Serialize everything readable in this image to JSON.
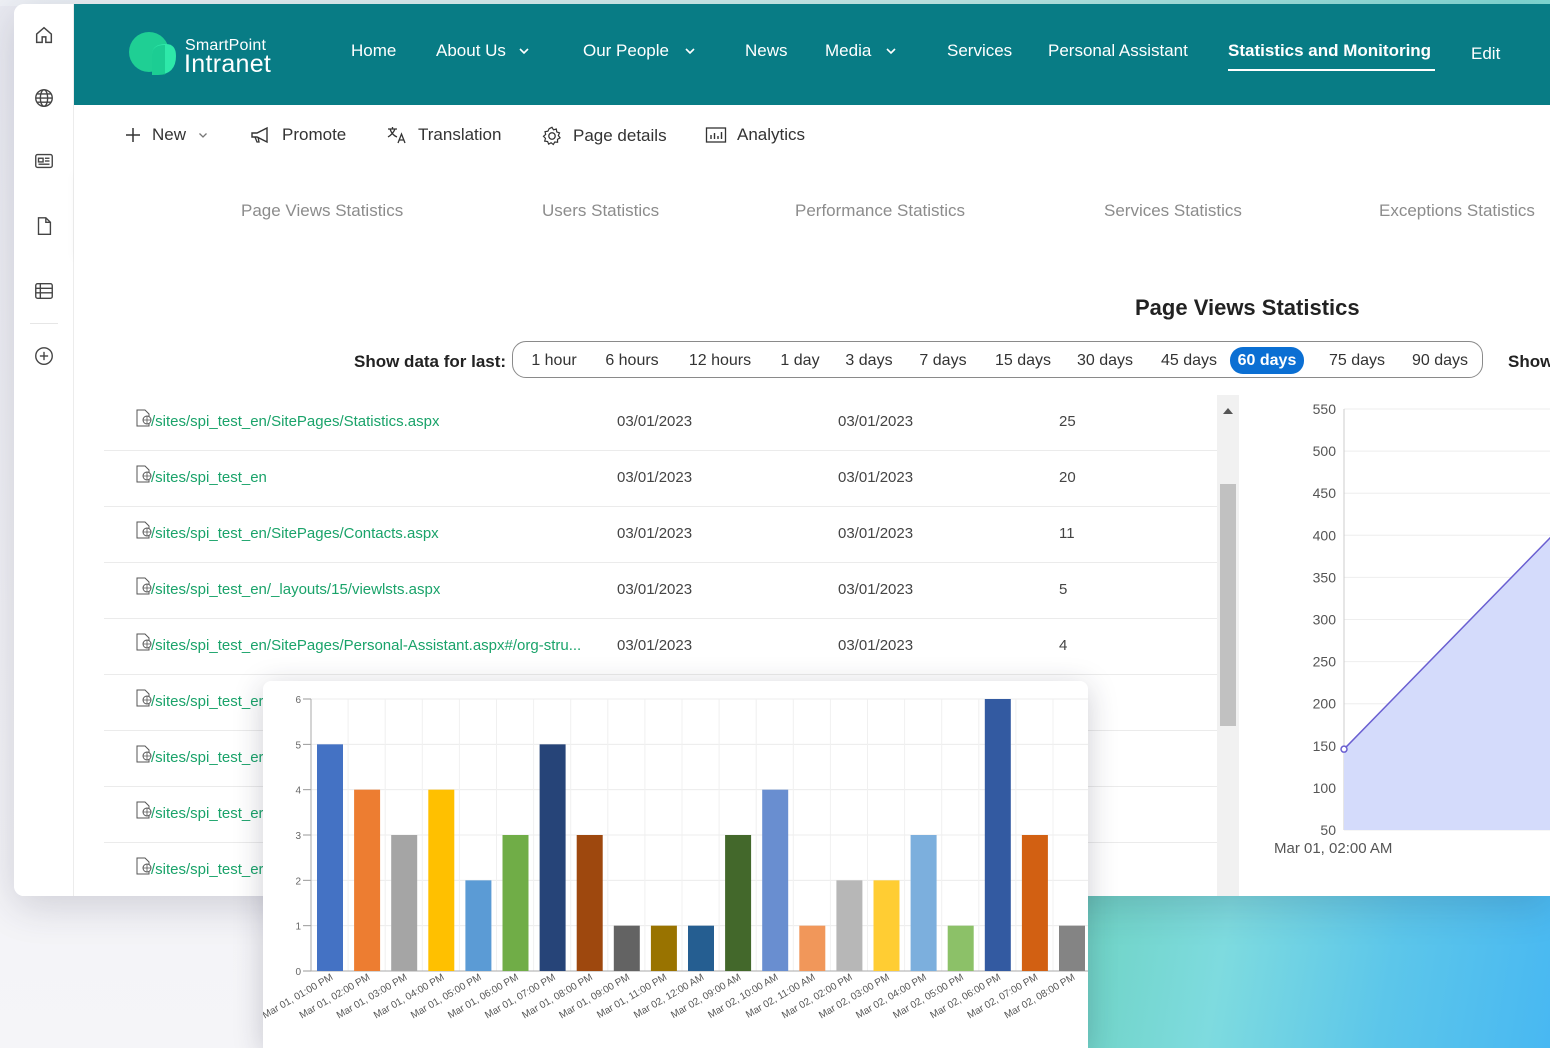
{
  "app": {
    "logo_line1": "SmartPoint",
    "logo_line2": "Intranet",
    "brand_color": "#087c85",
    "accent_green": "#1aa36a",
    "selected_blue": "#0b6fd3"
  },
  "rail": {
    "icons": [
      "home-icon",
      "globe-icon",
      "news-icon",
      "document-icon",
      "list-icon",
      "add-circle-icon"
    ]
  },
  "nav": {
    "items": [
      {
        "label": "Home",
        "has_chevron": false
      },
      {
        "label": "About Us",
        "has_chevron": true
      },
      {
        "label": "Our People",
        "has_chevron": true
      },
      {
        "label": "News",
        "has_chevron": false
      },
      {
        "label": "Media",
        "has_chevron": true
      },
      {
        "label": "Services",
        "has_chevron": false
      },
      {
        "label": "Personal Assistant",
        "has_chevron": false
      },
      {
        "label": "Statistics and Monitoring",
        "has_chevron": false,
        "active": true
      },
      {
        "label": "Edit",
        "has_chevron": false
      }
    ]
  },
  "commands": {
    "new": "New",
    "promote": "Promote",
    "translation": "Translation",
    "page_details": "Page details",
    "analytics": "Analytics"
  },
  "stat_tabs": [
    "Page Views Statistics",
    "Users Statistics",
    "Performance Statistics",
    "Services Statistics",
    "Exceptions Statistics"
  ],
  "page_views": {
    "title": "Page Views Statistics",
    "range_label": "Show data for last:",
    "ranges": [
      "1 hour",
      "6 hours",
      "12 hours",
      "1 day",
      "3 days",
      "7 days",
      "15 days",
      "30 days",
      "45 days",
      "60 days",
      "75 days",
      "90 days"
    ],
    "selected_range": "60 days",
    "show_cut": "Show",
    "rows": [
      {
        "url": "/sites/spi_test_en/SitePages/Statistics.aspx",
        "first": "03/01/2023",
        "last": "03/01/2023",
        "count": "25"
      },
      {
        "url": "/sites/spi_test_en",
        "first": "03/01/2023",
        "last": "03/01/2023",
        "count": "20"
      },
      {
        "url": "/sites/spi_test_en/SitePages/Contacts.aspx",
        "first": "03/01/2023",
        "last": "03/01/2023",
        "count": "11"
      },
      {
        "url": "/sites/spi_test_en/_layouts/15/viewlsts.aspx",
        "first": "03/01/2023",
        "last": "03/01/2023",
        "count": "5"
      },
      {
        "url": "/sites/spi_test_en/SitePages/Personal-Assistant.aspx#/org-stru...",
        "first": "03/01/2023",
        "last": "03/01/2023",
        "count": "4"
      },
      {
        "url": "/sites/spi_test_er",
        "first": "",
        "last": "",
        "count": ""
      },
      {
        "url": "/sites/spi_test_er",
        "first": "",
        "last": "",
        "count": ""
      },
      {
        "url": "/sites/spi_test_er",
        "first": "",
        "last": "",
        "count": ""
      },
      {
        "url": "/sites/spi_test_er",
        "first": "",
        "last": "",
        "count": ""
      }
    ]
  },
  "chart_data": [
    {
      "type": "area",
      "y_ticks": [
        550,
        500,
        450,
        400,
        350,
        300,
        250,
        200,
        150,
        100,
        50
      ],
      "ylim": [
        50,
        550
      ],
      "x_first_label": "Mar 01, 02:00 AM",
      "points": [
        {
          "x": 0,
          "y": 146
        },
        {
          "x": 1,
          "y": 420
        }
      ],
      "color": "#6a5fd1",
      "fill": "#d4dbfb"
    },
    {
      "type": "bar",
      "ylim": [
        0,
        6
      ],
      "y_ticks": [
        0,
        1,
        2,
        3,
        4,
        5,
        6
      ],
      "categories": [
        "Mar 01, 01:00 PM",
        "Mar 01, 02:00 PM",
        "Mar 01, 03:00 PM",
        "Mar 01, 04:00 PM",
        "Mar 01, 05:00 PM",
        "Mar 01, 06:00 PM",
        "Mar 01, 07:00 PM",
        "Mar 01, 08:00 PM",
        "Mar 01, 09:00 PM",
        "Mar 01, 11:00 PM",
        "Mar 02, 12:00 AM",
        "Mar 02, 09:00 AM",
        "Mar 02, 10:00 AM",
        "Mar 02, 11:00 AM",
        "Mar 02, 02:00 PM",
        "Mar 02, 03:00 PM",
        "Mar 02, 04:00 PM",
        "Mar 02, 05:00 PM",
        "Mar 02, 06:00 PM",
        "Mar 02, 07:00 PM",
        "Mar 02, 08:00 PM"
      ],
      "values": [
        5,
        4,
        3,
        4,
        2,
        3,
        5,
        3,
        1,
        1,
        1,
        3,
        4,
        1,
        2,
        2,
        3,
        1,
        6,
        3,
        1
      ],
      "colors": [
        "#4472c4",
        "#ed7d31",
        "#a5a5a5",
        "#ffc000",
        "#5b9bd5",
        "#70ad47",
        "#264478",
        "#9e480e",
        "#636363",
        "#997300",
        "#255e91",
        "#43682b",
        "#698ed0",
        "#f1975a",
        "#b7b7b7",
        "#ffcd33",
        "#7cafdd",
        "#8cc168",
        "#335aa1",
        "#d26012",
        "#848484"
      ]
    }
  ]
}
